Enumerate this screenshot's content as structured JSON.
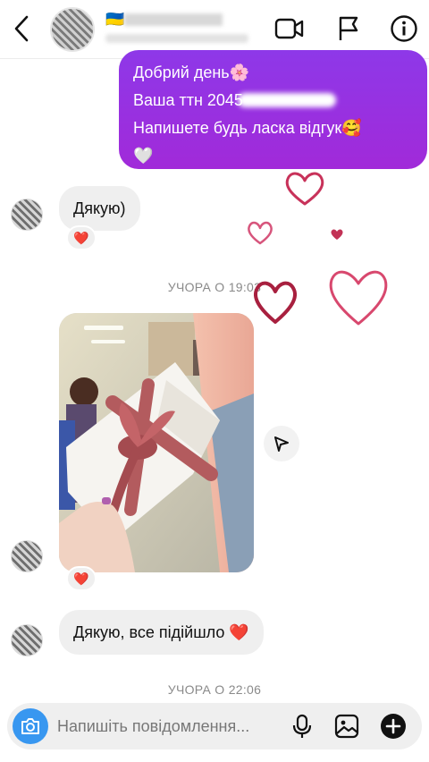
{
  "header": {
    "contact_name": "🇺🇦",
    "back_icon": "chevron-left-icon",
    "video_icon": "video-camera-icon",
    "flag_icon": "flag-icon",
    "info_icon": "info-icon"
  },
  "messages": {
    "sent": {
      "line1": "Добрий день🌸",
      "line2": "Ваша ттн 2045",
      "line3": "Напишете будь ласка відгук🥰",
      "line4": "🤍"
    },
    "reply1": {
      "text": "Дякую)",
      "reaction": "❤️"
    },
    "timestamp1": "УЧОРА О 19:03",
    "photo": {
      "reaction": "❤️"
    },
    "reply2": {
      "text": "Дякую, все підійшло ❤️"
    },
    "timestamp2": "УЧОРА О 22:06"
  },
  "composer": {
    "placeholder": "Напишіть повідомлення...",
    "camera_icon": "camera-icon",
    "mic_icon": "microphone-icon",
    "gallery_icon": "image-icon",
    "plus_icon": "plus-circle-icon"
  },
  "colors": {
    "sent_bubble": "#9b2fe0",
    "received_bubble": "#efefef",
    "camera_button": "#3897f0",
    "heart_decor": "#c8325a"
  }
}
